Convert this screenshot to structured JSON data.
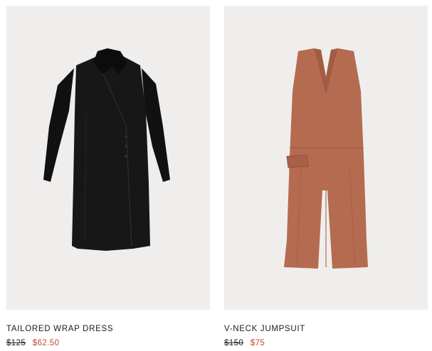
{
  "products": [
    {
      "name": "TAILORED WRAP DRESS",
      "original_price": "$125",
      "sale_price": "$62.50",
      "garment_color": "#151515",
      "image_background": "#efeeec"
    },
    {
      "name": "V-NECK JUMPSUIT",
      "original_price": "$150",
      "sale_price": "$75",
      "garment_color": "#b36a4f",
      "image_background": "#efeeec"
    }
  ],
  "colors": {
    "sale": "#c0492f",
    "text": "#1a1a1a"
  }
}
